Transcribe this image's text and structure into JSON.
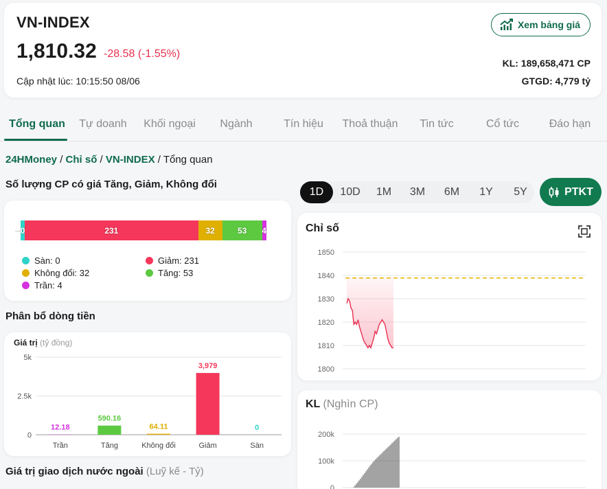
{
  "header": {
    "title": "VN-INDEX",
    "price": "1,810.32",
    "change": "-28.58 (-1.55%)",
    "updated": "Cập nhật lúc: 10:15:50 08/06",
    "board_button": "Xem bảng giá",
    "volume": "KL: 189,658,471 CP",
    "value": "GTGD: 4,779 tỷ"
  },
  "tabs": [
    "Tổng quan",
    "Tự doanh",
    "Khối ngoại",
    "Ngành",
    "Tín hiệu",
    "Thoả thuận",
    "Tin tức",
    "Cổ tức",
    "Đáo hạn"
  ],
  "breadcrumb": {
    "home": "24HMoney",
    "sep": " / ",
    "section": "Chỉ số",
    "index": "VN-INDEX",
    "current": "Tổng quan"
  },
  "count_section": {
    "title": "Số lượng CP có giá Tăng, Giảm, Không đổi",
    "segments": [
      {
        "label": "0",
        "value": 0,
        "color": "#2fd3c8"
      },
      {
        "label": "231",
        "value": 231,
        "color": "#f4375a"
      },
      {
        "label": "32",
        "value": 32,
        "color": "#e0b000"
      },
      {
        "label": "53",
        "value": 53,
        "color": "#5cc941"
      },
      {
        "label": "4",
        "value": 4,
        "color": "#d631e0"
      }
    ],
    "legend": [
      {
        "text": "Sàn: 0",
        "color": "#2fd3c8"
      },
      {
        "text": "Giảm: 231",
        "color": "#f4375a"
      },
      {
        "text": "Không đổi: 32",
        "color": "#e0b000"
      },
      {
        "text": "Tăng: 53",
        "color": "#5cc941"
      },
      {
        "text": "Trần: 4",
        "color": "#d631e0"
      }
    ]
  },
  "flow_section": {
    "title": "Phân bổ dòng tiền",
    "axis_title": "Giá trị",
    "axis_unit": "(tỷ đồng)"
  },
  "foreign_section": {
    "title": "Giá trị giao dịch nước ngoài",
    "sub": "(Luỹ kế - Tỷ)"
  },
  "periods": [
    "1D",
    "10D",
    "1M",
    "3M",
    "6M",
    "1Y",
    "5Y"
  ],
  "active_period": "1D",
  "ptkt_label": "PTKT",
  "index_chart_title": "Chỉ số",
  "vol_chart_title": "KL",
  "vol_chart_sub": "(Nghìn CP)",
  "chart_data": [
    {
      "type": "bar",
      "categories": [
        "Trần",
        "Tăng",
        "Không đổi",
        "Giảm",
        "Sàn"
      ],
      "values": [
        12.18,
        590.16,
        64.11,
        3979,
        0
      ],
      "value_labels": [
        "12.18",
        "590.16",
        "64.11",
        "3,979",
        "0"
      ],
      "colors": [
        "#d631e0",
        "#5cc941",
        "#e0b000",
        "#f4375a",
        "#2fd3c8"
      ],
      "ylim": [
        0,
        5000
      ],
      "yticks": [
        0,
        2500,
        5000
      ],
      "ytick_labels": [
        "0",
        "2.5k",
        "5k"
      ]
    },
    {
      "type": "line",
      "ylim": [
        1800,
        1850
      ],
      "yticks": [
        1800,
        1810,
        1820,
        1830,
        1840,
        1850
      ],
      "reference": 1838.9,
      "x": [
        0,
        1,
        2,
        3,
        4,
        5,
        6,
        7,
        8,
        9,
        10,
        11,
        12,
        13,
        14,
        15,
        16,
        17,
        18,
        19,
        20,
        21,
        22,
        23,
        24,
        25,
        26,
        27,
        28,
        29,
        30,
        31,
        32,
        33
      ],
      "y": [
        1828,
        1830,
        1829,
        1826,
        1825,
        1819,
        1820,
        1819,
        1821,
        1818,
        1816,
        1814,
        1812,
        1811,
        1810,
        1809,
        1810,
        1809,
        1811,
        1813,
        1816,
        1815,
        1817,
        1819,
        1820,
        1821,
        1820,
        1819,
        1816,
        1813,
        1811,
        1810,
        1809,
        1809
      ],
      "x_total": 34
    },
    {
      "type": "bar",
      "ylim": [
        0,
        200000
      ],
      "yticks": [
        0,
        100000,
        200000
      ],
      "ytick_labels": [
        "0",
        "100k",
        "200k"
      ],
      "values": [
        2000,
        8000,
        14000,
        20000,
        27000,
        33000,
        40000,
        47000,
        54000,
        61000,
        68000,
        75000,
        82000,
        88000,
        95000,
        100000,
        106000,
        111000,
        116000,
        121000,
        126000,
        131000,
        136000,
        141000,
        146000,
        151000,
        156000,
        161000,
        166000,
        171000,
        176000,
        181000,
        186000,
        189658
      ]
    }
  ]
}
